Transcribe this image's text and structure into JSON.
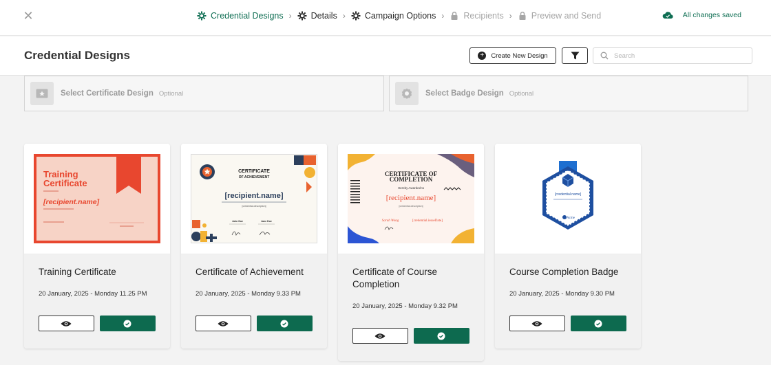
{
  "stepper": {
    "steps": [
      {
        "label": "Credential Designs",
        "state": "active",
        "icon": "gear-icon"
      },
      {
        "label": "Details",
        "state": "done",
        "icon": "gear-icon"
      },
      {
        "label": "Campaign Options",
        "state": "done",
        "icon": "gear-icon"
      },
      {
        "label": "Recipients",
        "state": "locked",
        "icon": "lock-icon"
      },
      {
        "label": "Preview and Send",
        "state": "locked",
        "icon": "lock-icon"
      }
    ],
    "saved_status": "All changes saved"
  },
  "header": {
    "title": "Credential Designs",
    "create_label": "Create New Design",
    "search_placeholder": "Search"
  },
  "selectors": {
    "certificate": {
      "label": "Select Certificate Design",
      "optional": "Optional"
    },
    "badge": {
      "label": "Select Badge Design",
      "optional": "Optional"
    }
  },
  "cards": [
    {
      "name": "Training Certificate",
      "date": "20 January, 2025 - Monday 11.25 PM"
    },
    {
      "name": "Certificate of Achievement",
      "date": "20 January, 2025 - Monday 9.33 PM"
    },
    {
      "name": "Certificate of Course Completion",
      "date": "20 January, 2025 - Monday 9.32 PM"
    },
    {
      "name": "Course Completion Badge",
      "date": "20 January, 2025 - Monday 9.30 PM"
    }
  ],
  "thumbs": {
    "training": {
      "title1": "Training",
      "title2": "Certificate",
      "name": "[recipient.name]"
    },
    "achievement": {
      "title1": "CERTIFICATE",
      "title2": "OF ACHIEVEMENT",
      "name": "[recipient.name]",
      "desc": "[credential.description]",
      "sig1": "John Doe",
      "sig2": "Jane Doe"
    },
    "completion": {
      "title1": "CERTIFICATE OF",
      "title2": "COMPLETION",
      "sub": "Hereby Awarded to",
      "name": "[recipient.name]",
      "desc": "[credential.description]",
      "sig": "Sarah Wong",
      "date": "[credential.issueDate]"
    },
    "badge": {
      "name": "[credential.name]",
      "brand": "Acme"
    }
  },
  "colors": {
    "accent": "#0d6a4f",
    "active_step": "#0f6e53"
  }
}
